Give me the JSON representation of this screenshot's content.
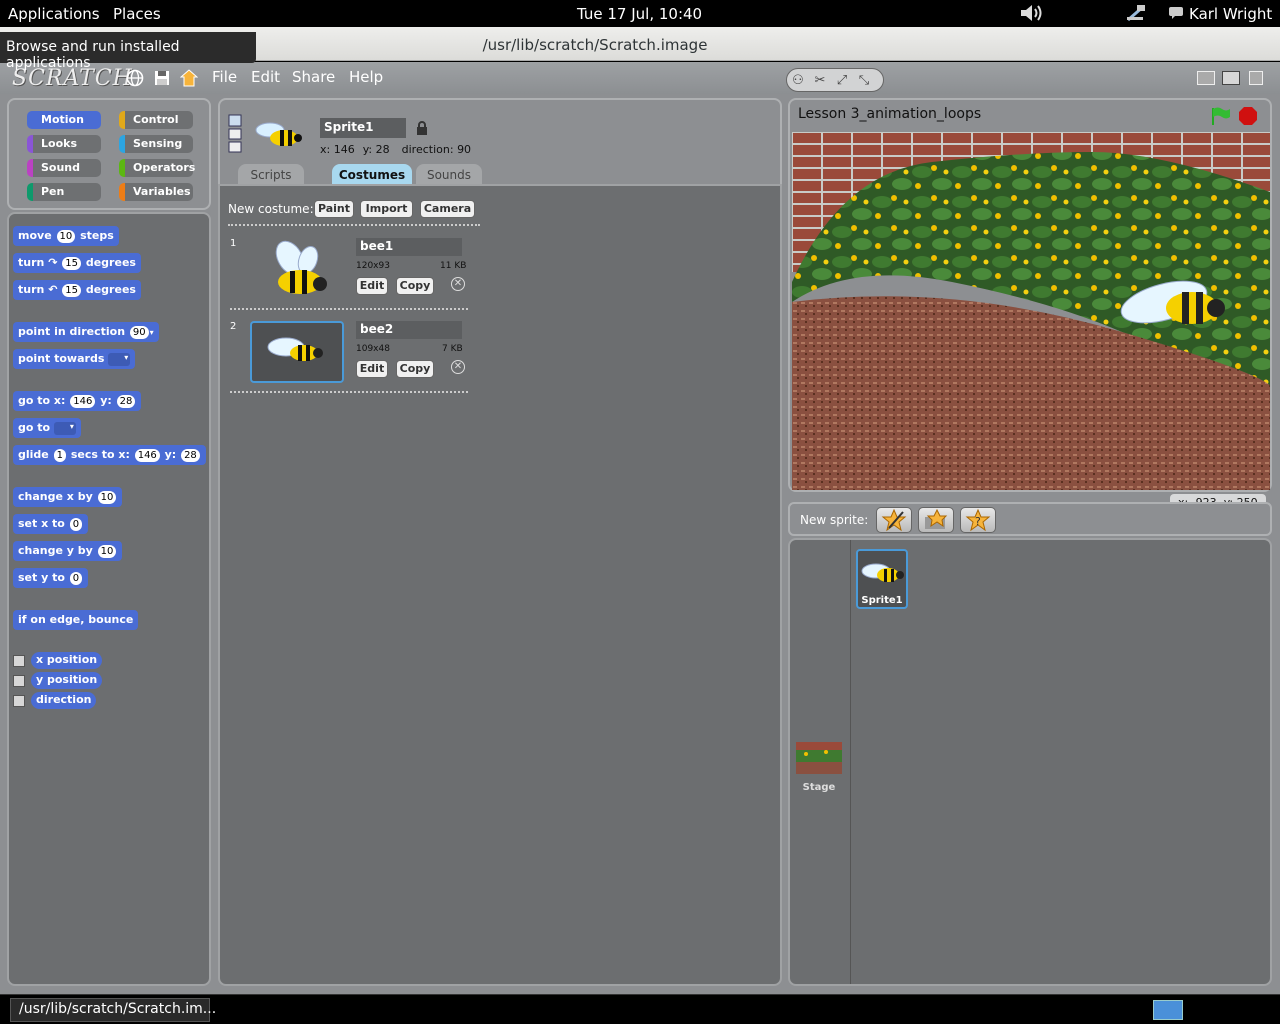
{
  "top_panel": {
    "applications": "Applications",
    "places": "Places",
    "clock": "Tue 17 Jul, 10:40",
    "user": "Karl Wright"
  },
  "window": {
    "title": "/usr/lib/scratch/Scratch.image",
    "tooltip": "Browse and run installed applications",
    "minimize": "–",
    "maximize": "□",
    "close": "✕"
  },
  "scratch_menu": {
    "logo": "SCRATCH",
    "file": "File",
    "edit": "Edit",
    "share": "Share",
    "help": "Help"
  },
  "categories": [
    {
      "label": "Motion",
      "color": "#4a6cd4"
    },
    {
      "label": "Control",
      "color": "#e1a91a"
    },
    {
      "label": "Looks",
      "color": "#8a55d7"
    },
    {
      "label": "Sensing",
      "color": "#2ca5e2"
    },
    {
      "label": "Sound",
      "color": "#bb42c3"
    },
    {
      "label": "Operators",
      "color": "#5cb712"
    },
    {
      "label": "Pen",
      "color": "#0e9a6c"
    },
    {
      "label": "Variables",
      "color": "#ee7d16"
    }
  ],
  "blocks": {
    "move": {
      "a": "move",
      "v": "10",
      "b": "steps"
    },
    "turn_cw": {
      "a": "turn",
      "v": "15",
      "b": "degrees"
    },
    "turn_ccw": {
      "a": "turn",
      "v": "15",
      "b": "degrees"
    },
    "point_dir": {
      "a": "point in direction",
      "v": "90"
    },
    "point_towards": {
      "a": "point towards"
    },
    "goto_xy": {
      "a": "go to x:",
      "x": "146",
      "b": "y:",
      "y": "28"
    },
    "goto": {
      "a": "go to"
    },
    "glide": {
      "a": "glide",
      "s": "1",
      "b": "secs to x:",
      "x": "146",
      "c": "y:",
      "y": "28"
    },
    "change_x": {
      "a": "change x by",
      "v": "10"
    },
    "set_x": {
      "a": "set x to",
      "v": "0"
    },
    "change_y": {
      "a": "change y by",
      "v": "10"
    },
    "set_y": {
      "a": "set y to",
      "v": "0"
    },
    "bounce": {
      "a": "if on edge, bounce"
    },
    "x_position": "x position",
    "y_position": "y position",
    "direction": "direction"
  },
  "sprite": {
    "name": "Sprite1",
    "x_label": "x:",
    "x": "146",
    "y_label": "y:",
    "y": "28",
    "dir_label": "direction:",
    "direction": "90"
  },
  "tabs": {
    "scripts": "Scripts",
    "costumes": "Costumes",
    "sounds": "Sounds",
    "active": "Costumes"
  },
  "costumes": {
    "new_label": "New costume:",
    "paint": "Paint",
    "import": "Import",
    "camera": "Camera",
    "items": [
      {
        "index": "1",
        "name": "bee1",
        "dims": "120x93",
        "size": "11 KB",
        "edit": "Edit",
        "copy": "Copy"
      },
      {
        "index": "2",
        "name": "bee2",
        "dims": "109x48",
        "size": "7 KB",
        "edit": "Edit",
        "copy": "Copy"
      }
    ]
  },
  "stage": {
    "title": "Lesson 3_animation_loops",
    "mouse_x": "x: -923",
    "mouse_y": "y: 250"
  },
  "sprite_library": {
    "new_sprite": "New sprite:",
    "sprite1": "Sprite1",
    "stage": "Stage"
  },
  "taskbar": {
    "item": "/usr/lib/scratch/Scratch.im..."
  }
}
